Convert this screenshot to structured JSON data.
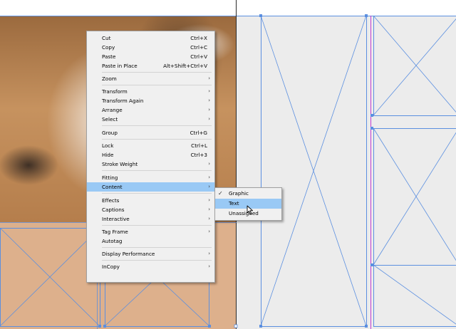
{
  "context_menu": {
    "items": [
      {
        "label": "Cut",
        "shortcut": "Ctrl+X",
        "has_submenu": false
      },
      {
        "label": "Copy",
        "shortcut": "Ctrl+C",
        "has_submenu": false
      },
      {
        "label": "Paste",
        "shortcut": "Ctrl+V",
        "has_submenu": false
      },
      {
        "label": "Paste in Place",
        "shortcut": "Alt+Shift+Ctrl+V",
        "has_submenu": false
      },
      {
        "label": "Zoom",
        "shortcut": "",
        "has_submenu": true
      },
      {
        "label": "Transform",
        "shortcut": "",
        "has_submenu": true
      },
      {
        "label": "Transform Again",
        "shortcut": "",
        "has_submenu": true
      },
      {
        "label": "Arrange",
        "shortcut": "",
        "has_submenu": true
      },
      {
        "label": "Select",
        "shortcut": "",
        "has_submenu": true
      },
      {
        "label": "Group",
        "shortcut": "Ctrl+G",
        "has_submenu": false
      },
      {
        "label": "Lock",
        "shortcut": "Ctrl+L",
        "has_submenu": false
      },
      {
        "label": "Hide",
        "shortcut": "Ctrl+3",
        "has_submenu": false
      },
      {
        "label": "Stroke Weight",
        "shortcut": "",
        "has_submenu": true
      },
      {
        "label": "Fitting",
        "shortcut": "",
        "has_submenu": true
      },
      {
        "label": "Content",
        "shortcut": "",
        "has_submenu": true,
        "highlighted": true
      },
      {
        "label": "Effects",
        "shortcut": "",
        "has_submenu": true
      },
      {
        "label": "Captions",
        "shortcut": "",
        "has_submenu": true
      },
      {
        "label": "Interactive",
        "shortcut": "",
        "has_submenu": true
      },
      {
        "label": "Tag Frame",
        "shortcut": "",
        "has_submenu": true
      },
      {
        "label": "Autotag",
        "shortcut": "",
        "has_submenu": false
      },
      {
        "label": "Display Performance",
        "shortcut": "",
        "has_submenu": true
      },
      {
        "label": "InCopy",
        "shortcut": "",
        "has_submenu": true
      }
    ],
    "submenu_arrow": "›"
  },
  "content_submenu": {
    "items": [
      {
        "label": "Graphic",
        "checked": true
      },
      {
        "label": "Text",
        "checked": false,
        "highlighted": true
      },
      {
        "label": "Unassigned",
        "checked": false
      }
    ],
    "check_glyph": "✓"
  },
  "colors": {
    "guide": "#5b8fe0",
    "margin_guide": "#c23ad1",
    "menu_highlight": "#99c9f5",
    "menu_bg": "#f0f0f0"
  }
}
